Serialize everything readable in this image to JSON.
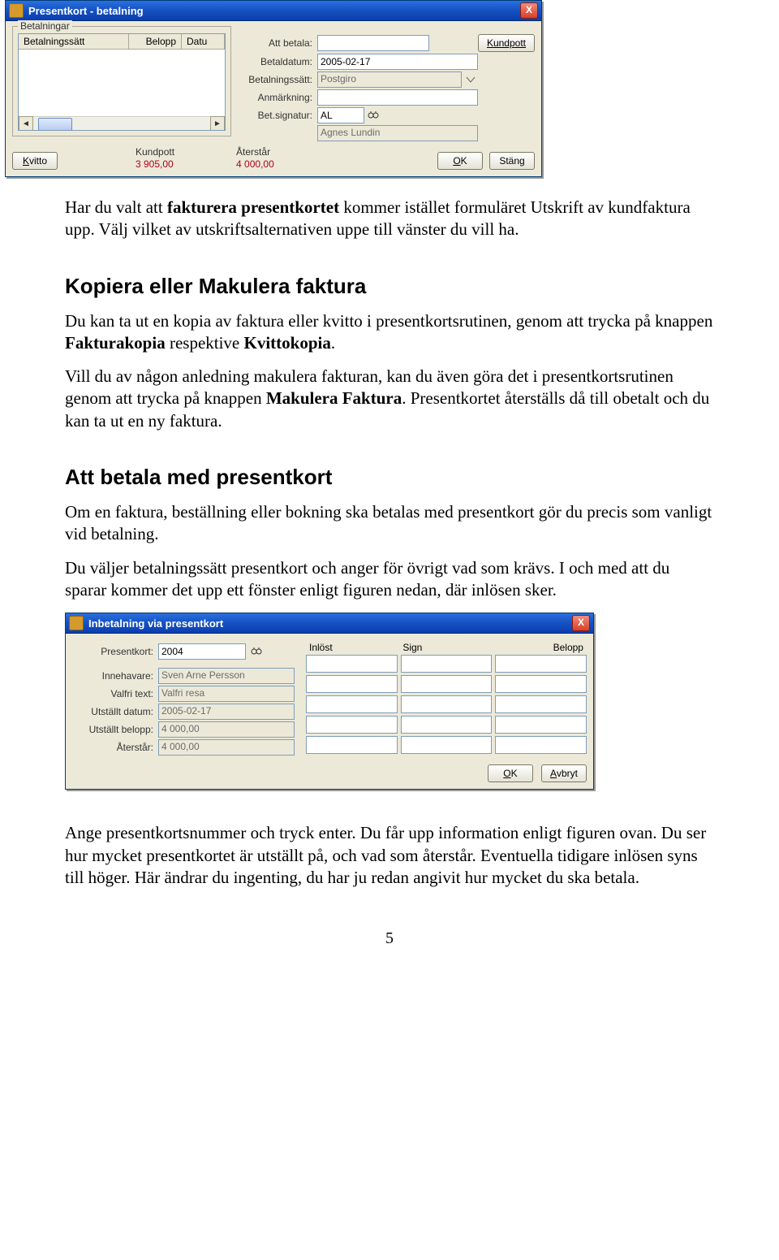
{
  "dlg1": {
    "title": "Presentkort - betalning",
    "close": "X",
    "group_title": "Betalningar",
    "cols": {
      "c1": "Betalningssätt",
      "c2": "Belopp",
      "c3": "Datu"
    },
    "right": {
      "att_betala_lbl": "Att betala:",
      "att_betala_val": "",
      "kundpott_btn": "Kundpott",
      "betaldatum_lbl": "Betaldatum:",
      "betaldatum_val": "2005-02-17",
      "betsatt_lbl": "Betalningssätt:",
      "betsatt_val": "Postgiro",
      "anm_lbl": "Anmärkning:",
      "anm_val": "",
      "sign_lbl": "Bet.signatur:",
      "sign_val": "AL",
      "sign_name": "Agnes Lundin"
    },
    "footer": {
      "kvitto": "Kvitto",
      "kundpott_lbl": "Kundpott",
      "kundpott_val": "3 905,00",
      "aterstar_lbl": "Återstår",
      "aterstar_val": "4 000,00",
      "ok": "OK",
      "stang": "Stäng"
    }
  },
  "para1a": "Har du valt att ",
  "para1b": "fakturera presentkortet",
  "para1c": " kommer istället formuläret Utskrift av kundfaktura upp. Välj vilket av utskriftsalternativen uppe till vänster du vill ha.",
  "h_kopiera": "Kopiera eller Makulera faktura",
  "para2a": "Du kan ta ut en kopia av faktura eller kvitto i presentkortsrutinen, genom att trycka på knappen ",
  "para2b": "Fakturakopia",
  "para2c": " respektive ",
  "para2d": "Kvittokopia",
  "para2e": ".",
  "para3a": "Vill du av någon anledning makulera fakturan, kan du även göra det i presentkortsrutinen genom att trycka på knappen ",
  "para3b": "Makulera Faktura",
  "para3c": ". Presentkortet återställs då till obetalt och du kan ta ut en ny faktura.",
  "h_betala": "Att betala med presentkort",
  "para4": "Om en faktura, beställning eller bokning ska betalas med presentkort gör du precis som vanligt vid betalning.",
  "para5": "Du väljer betalningssätt presentkort och anger för övrigt vad som krävs. I och med att du sparar kommer det upp ett fönster enligt figuren nedan, där inlösen sker.",
  "dlg2": {
    "title": "Inbetalning via presentkort",
    "close": "X",
    "left": {
      "presentkort_lbl": "Presentkort:",
      "presentkort_val": "2004",
      "innehavare_lbl": "Innehavare:",
      "innehavare_val": "Sven Arne Persson",
      "valfri_lbl": "Valfri text:",
      "valfri_val": "Valfri resa",
      "utst_datum_lbl": "Utställt datum:",
      "utst_datum_val": "2005-02-17",
      "utst_belopp_lbl": "Utställt belopp:",
      "utst_belopp_val": "4 000,00",
      "aterstar_lbl": "Återstår:",
      "aterstar_val": "4 000,00"
    },
    "right": {
      "h1": "Inlöst",
      "h2": "Sign",
      "h3": "Belopp"
    },
    "footer": {
      "ok": "OK",
      "avbryt": "Avbryt"
    }
  },
  "para6": "Ange presentkortsnummer och tryck enter. Du får upp information enligt figuren ovan. Du ser hur mycket presentkortet är utställt på, och vad som återstår. Eventuella tidigare inlösen syns till höger. Här ändrar du ingenting, du har ju redan angivit hur mycket du ska betala.",
  "page_number": "5"
}
